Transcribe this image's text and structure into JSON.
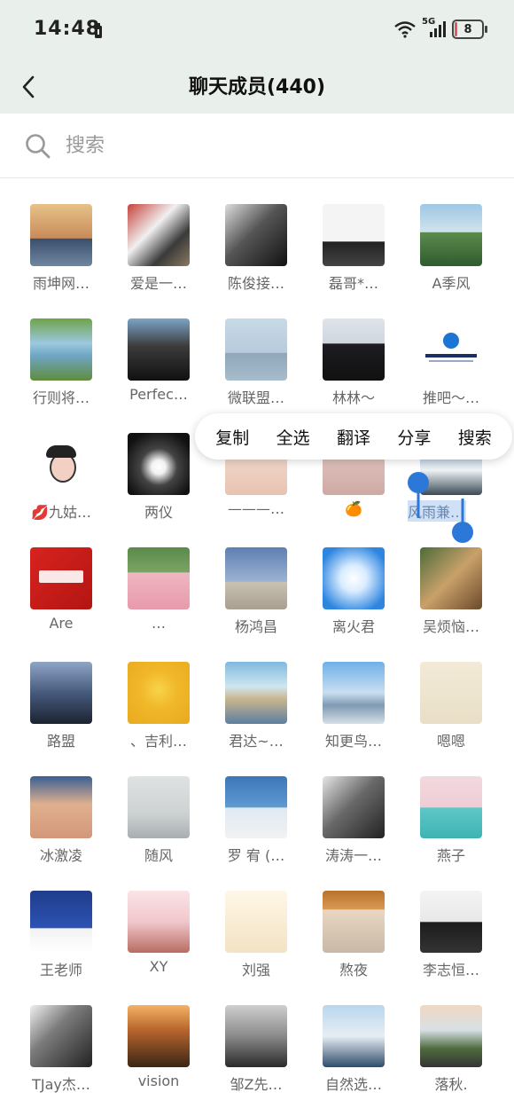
{
  "status": {
    "time": "14:48",
    "network": "5G",
    "battery": "8"
  },
  "header": {
    "title": "聊天成员(440)"
  },
  "search": {
    "placeholder": "搜索",
    "value": ""
  },
  "context_menu": [
    "复制",
    "全选",
    "翻译",
    "分享",
    "搜索"
  ],
  "colors": {
    "header_bg": "#e9efea",
    "selection": "#2b78d8",
    "name": "#666666"
  },
  "members": [
    {
      "name": "雨坤网…",
      "img": "sunset"
    },
    {
      "name": "爱是一…",
      "img": "man-outdoor"
    },
    {
      "name": "陈俊接…",
      "img": "man-bw"
    },
    {
      "name": "磊哥*…",
      "img": "man-suit"
    },
    {
      "name": "A季风",
      "img": "hills"
    },
    {
      "name": "行则将…",
      "img": "lake"
    },
    {
      "name": "Perfec…",
      "img": "mask-man"
    },
    {
      "name": "微联盟…",
      "img": "sea"
    },
    {
      "name": "林林～",
      "img": "woman-black"
    },
    {
      "name": "推吧～…",
      "img": "logo"
    },
    {
      "name": "💋九姑…",
      "img": "cartoon"
    },
    {
      "name": "两仪",
      "img": "light"
    },
    {
      "name": "———…",
      "img": "woman-face"
    },
    {
      "name": "🍊",
      "img": "cat"
    },
    {
      "name": "风雨兼…",
      "img": "mountain",
      "selected": true
    },
    {
      "name": "Are",
      "img": "red-brand"
    },
    {
      "name": "  …",
      "img": "pig"
    },
    {
      "name": "杨鸿昌",
      "img": "beach"
    },
    {
      "name": "离火君",
      "img": "cloud"
    },
    {
      "name": "吴烦恼…",
      "img": "street"
    },
    {
      "name": "路盟",
      "img": "dark-man"
    },
    {
      "name": "、吉利…",
      "img": "sunflower"
    },
    {
      "name": "君达~…",
      "img": "city"
    },
    {
      "name": "知更鸟…",
      "img": "sky"
    },
    {
      "name": "嗯嗯",
      "img": "doodle"
    },
    {
      "name": "冰激凌",
      "img": "baby"
    },
    {
      "name": "随风",
      "img": "fog"
    },
    {
      "name": "罗 宥 (…",
      "img": "man-sea"
    },
    {
      "name": "涛涛一…",
      "img": "young-man"
    },
    {
      "name": "燕子",
      "img": "girl"
    },
    {
      "name": "王老师",
      "img": "teacher"
    },
    {
      "name": "XY",
      "img": "anime-girl"
    },
    {
      "name": "刘强",
      "img": "cartoon-kid"
    },
    {
      "name": "熬夜",
      "img": "cat-meme"
    },
    {
      "name": "李志恒…",
      "img": "man-formal"
    },
    {
      "name": "TJay杰…",
      "img": "bw-portrait"
    },
    {
      "name": "vision",
      "img": "window-sunset"
    },
    {
      "name": "邹Z先…",
      "img": "man-shirtless"
    },
    {
      "name": "自然选…",
      "img": "guitar"
    },
    {
      "name": "落秋.",
      "img": "road"
    }
  ]
}
